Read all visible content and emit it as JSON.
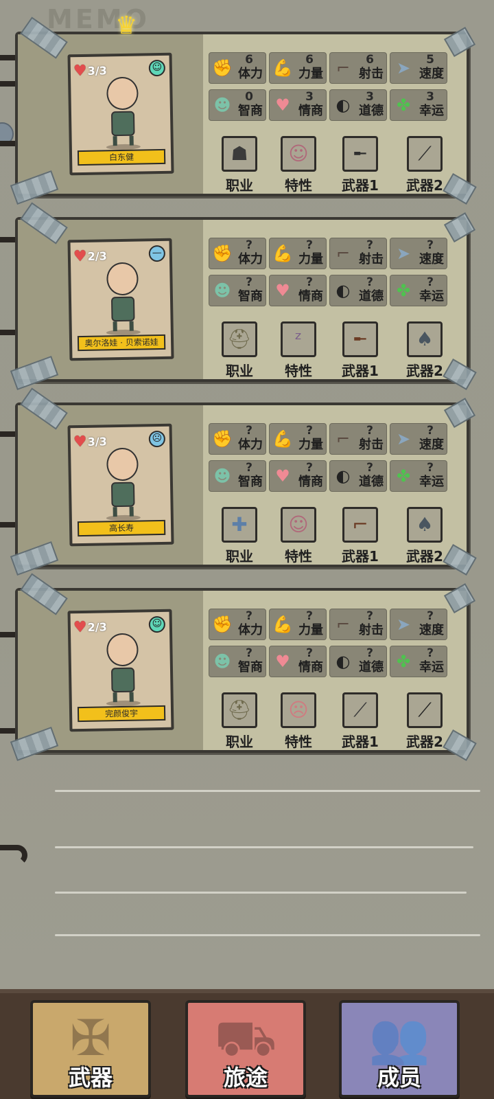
{
  "page": {
    "memo_title": "MEMO"
  },
  "members": [
    {
      "name": "白东健",
      "hp": "3/3",
      "mood": "happy",
      "leader": true,
      "stats": [
        {
          "icon": "stamina-icon",
          "value": "6",
          "label": "体力"
        },
        {
          "icon": "strength-icon",
          "value": "6",
          "label": "力量"
        },
        {
          "icon": "shooting-icon",
          "value": "6",
          "label": "射击"
        },
        {
          "icon": "speed-icon",
          "value": "5",
          "label": "速度"
        },
        {
          "icon": "iq-icon",
          "value": "0",
          "label": "智商"
        },
        {
          "icon": "eq-icon",
          "value": "3",
          "label": "情商"
        },
        {
          "icon": "morality-icon",
          "value": "3",
          "label": "道德"
        },
        {
          "icon": "luck-icon",
          "value": "3",
          "label": "幸运"
        }
      ],
      "slots": [
        {
          "icon": "job-bodyguard-icon",
          "label": "职业"
        },
        {
          "icon": "trait-icon",
          "label": "特性"
        },
        {
          "icon": "sniper-rifle-icon",
          "label": "武器1"
        },
        {
          "icon": "machete-icon",
          "label": "武器2"
        }
      ]
    },
    {
      "name": "奥尔洛娃 · 贝索诺娃",
      "hp": "2/3",
      "mood": "neutral",
      "leader": false,
      "stats": [
        {
          "icon": "stamina-icon",
          "value": "?",
          "label": "体力"
        },
        {
          "icon": "strength-icon",
          "value": "?",
          "label": "力量"
        },
        {
          "icon": "shooting-icon",
          "value": "?",
          "label": "射击"
        },
        {
          "icon": "speed-icon",
          "value": "?",
          "label": "速度"
        },
        {
          "icon": "iq-icon",
          "value": "?",
          "label": "智商"
        },
        {
          "icon": "eq-icon",
          "value": "?",
          "label": "情商"
        },
        {
          "icon": "morality-icon",
          "value": "?",
          "label": "道德"
        },
        {
          "icon": "luck-icon",
          "value": "?",
          "label": "幸运"
        }
      ],
      "slots": [
        {
          "icon": "job-builder-icon",
          "label": "职业"
        },
        {
          "icon": "trait-sleepy-icon",
          "label": "特性"
        },
        {
          "icon": "shotgun-icon",
          "label": "武器1"
        },
        {
          "icon": "shovel-icon",
          "label": "武器2"
        }
      ]
    },
    {
      "name": "高长寿",
      "hp": "3/3",
      "mood": "sad",
      "leader": false,
      "stats": [
        {
          "icon": "stamina-icon",
          "value": "?",
          "label": "体力"
        },
        {
          "icon": "strength-icon",
          "value": "?",
          "label": "力量"
        },
        {
          "icon": "shooting-icon",
          "value": "?",
          "label": "射击"
        },
        {
          "icon": "speed-icon",
          "value": "?",
          "label": "速度"
        },
        {
          "icon": "iq-icon",
          "value": "?",
          "label": "智商"
        },
        {
          "icon": "eq-icon",
          "value": "?",
          "label": "情商"
        },
        {
          "icon": "morality-icon",
          "value": "?",
          "label": "道德"
        },
        {
          "icon": "luck-icon",
          "value": "?",
          "label": "幸运"
        }
      ],
      "slots": [
        {
          "icon": "job-doctor-icon",
          "label": "职业"
        },
        {
          "icon": "trait-icon",
          "label": "特性"
        },
        {
          "icon": "revolver-icon",
          "label": "武器1"
        },
        {
          "icon": "shovel-icon",
          "label": "武器2"
        }
      ]
    },
    {
      "name": "完颜俊宇",
      "hp": "2/3",
      "mood": "happy",
      "leader": false,
      "stats": [
        {
          "icon": "stamina-icon",
          "value": "?",
          "label": "体力"
        },
        {
          "icon": "strength-icon",
          "value": "?",
          "label": "力量"
        },
        {
          "icon": "shooting-icon",
          "value": "?",
          "label": "射击"
        },
        {
          "icon": "speed-icon",
          "value": "?",
          "label": "速度"
        },
        {
          "icon": "iq-icon",
          "value": "?",
          "label": "智商"
        },
        {
          "icon": "eq-icon",
          "value": "?",
          "label": "情商"
        },
        {
          "icon": "morality-icon",
          "value": "?",
          "label": "道德"
        },
        {
          "icon": "luck-icon",
          "value": "?",
          "label": "幸运"
        }
      ],
      "slots": [
        {
          "icon": "job-builder-icon",
          "label": "职业"
        },
        {
          "icon": "trait-sick-icon",
          "label": "特性"
        },
        {
          "icon": "bat-icon",
          "label": "武器1"
        },
        {
          "icon": "crowbar-icon",
          "label": "武器2"
        }
      ]
    }
  ],
  "nav": {
    "weapons": "武器",
    "journey": "旅途",
    "members": "成员"
  },
  "colors": {
    "nameplate": "#f2c01b",
    "nav_weapons": "#c9a86c",
    "nav_journey": "#d77b73",
    "nav_members": "#8a86b8"
  }
}
